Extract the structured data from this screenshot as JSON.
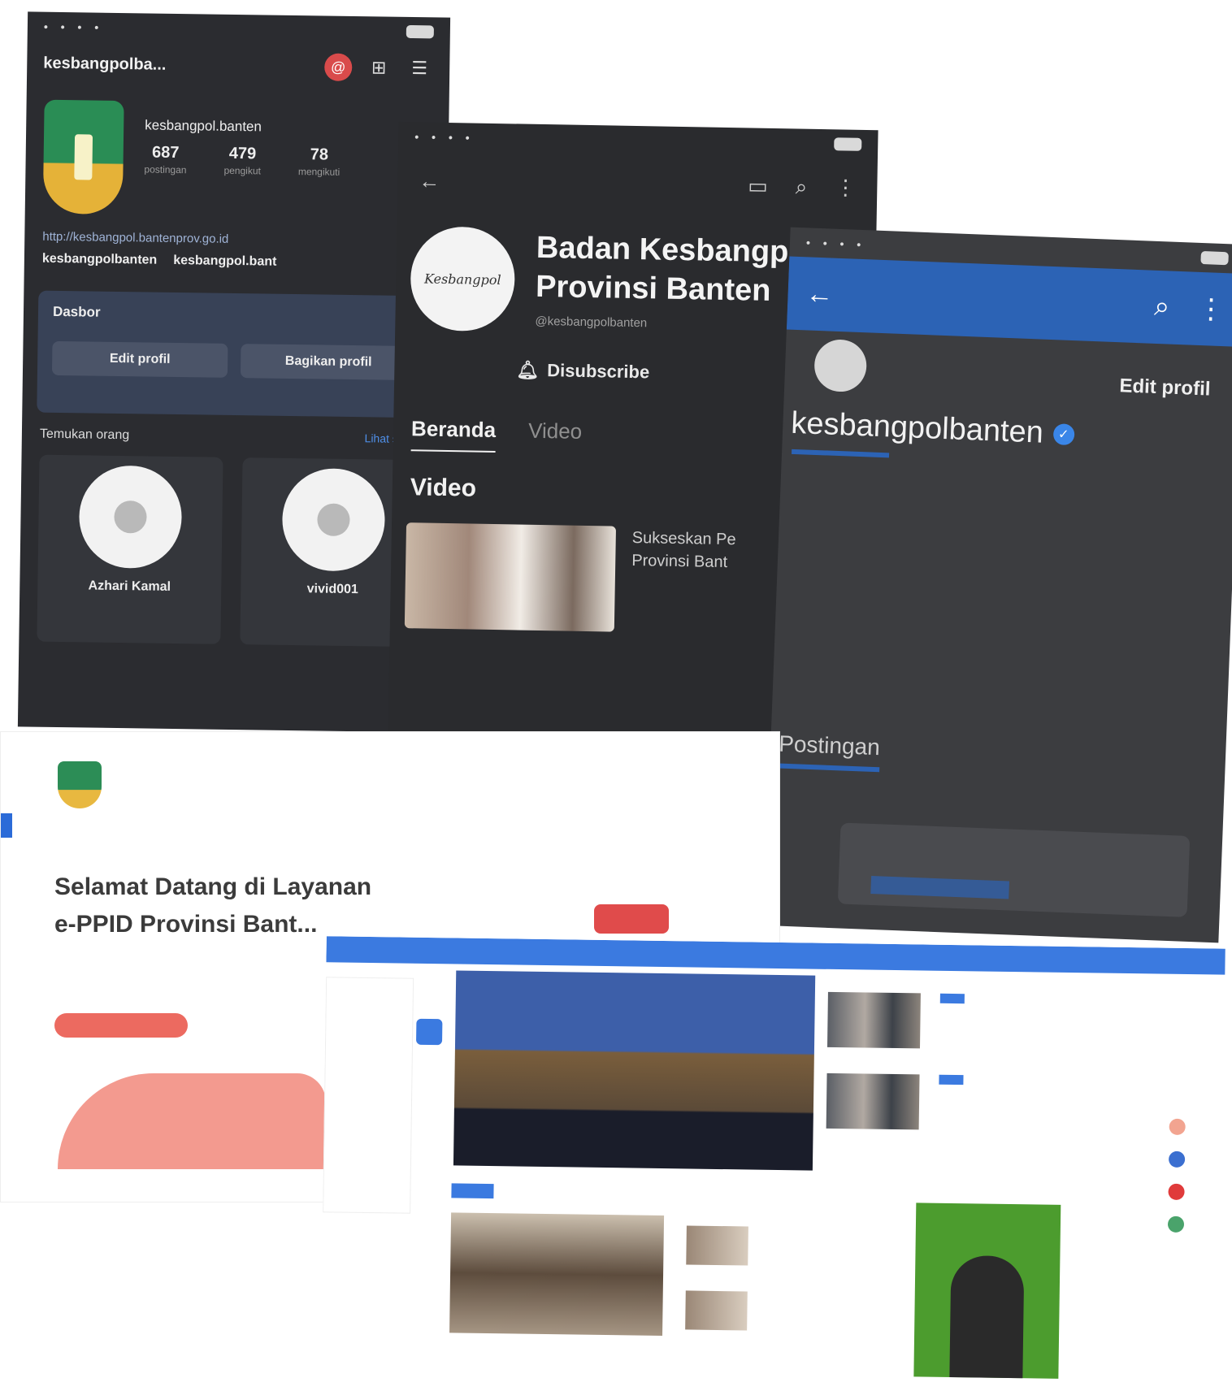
{
  "instagram": {
    "username": "kesbangpolba...",
    "profile_name": "kesbangpol.banten",
    "stats": [
      {
        "value": "687",
        "label": "postingan"
      },
      {
        "value": "479",
        "label": "pengikut"
      },
      {
        "value": "78",
        "label": "mengikuti"
      }
    ],
    "link": "http://kesbangpol.bantenprov.go.id",
    "threads": [
      "kesbangpolbanten",
      "kesbangpol.bant"
    ],
    "dashboard_title": "Dasbor",
    "dashboard_sub": "",
    "edit_button": "Edit profil",
    "share_button": "Bagikan profil",
    "suggest_title": "Temukan orang",
    "see_all": "Lihat semua",
    "suggestions": [
      {
        "name": "Azhari Kamal",
        "sub": ""
      },
      {
        "name": "vivid001",
        "sub": ""
      }
    ]
  },
  "youtube": {
    "channel_title_line1": "Badan Kesbangp",
    "channel_title_line2": "Provinsi Banten",
    "handle": "@kesbangpolbanten",
    "logo_text": "Kesbangpol",
    "subscribed_label": "Disubscribe",
    "tabs": [
      "Beranda",
      "Video"
    ],
    "section": "Video",
    "video_title_line1": "Sukseskan Pe",
    "video_title_line2": "Provinsi Bant"
  },
  "threads": {
    "edit_label": "Edit profil",
    "username": "kesbangpolbanten",
    "tab_label": "Postingan"
  },
  "ppid": {
    "headline_line1": "Selamat Datang di Layanan",
    "headline_line2": "e-PPID Provinsi Bant..."
  },
  "colors": {
    "threads_blue": "#2c63b5",
    "ppid_red": "#ec6a60",
    "news_blue": "#3b7ae0"
  }
}
